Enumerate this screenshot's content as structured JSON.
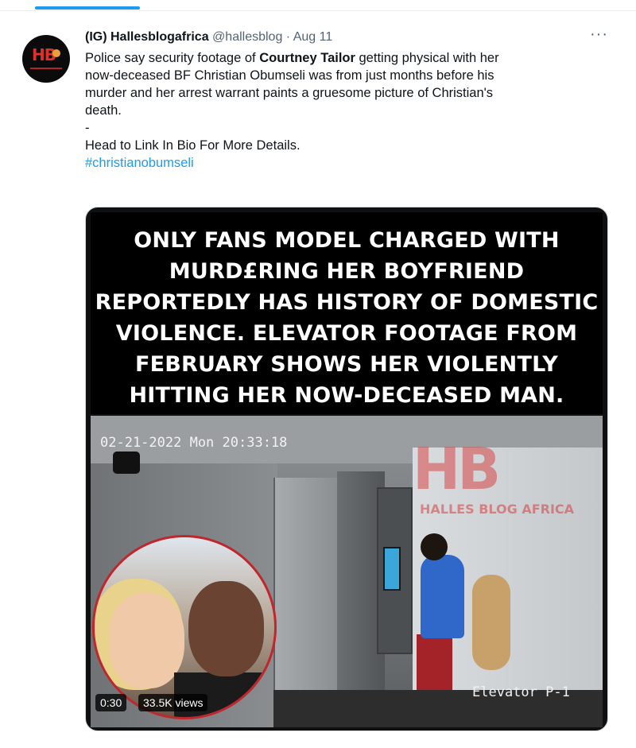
{
  "tweet": {
    "author_name": "(IG) Hallesblogafrica",
    "handle": "@hallesblog",
    "separator": "·",
    "date": "Aug 11",
    "more_label": "···",
    "avatar_icon": "hallesblog-logo-icon",
    "text": {
      "line1_before": "Police say security footage of ",
      "line1_bold": "Courtney Tailor",
      "line1_after": " getting physical with her",
      "line2": "now-deceased BF Christian Obumseli was from just months before his",
      "line3": "murder  and her arrest warrant paints a gruesome picture of Christian's",
      "line4": "death.",
      "line5": "-",
      "line6": "Head to Link In Bio For More Details.",
      "hashtag": "#christianobumseli"
    }
  },
  "media": {
    "caption_lines": [
      "ONLY FANS MODEL CHARGED WITH",
      "MURD£RING HER BOYFRIEND",
      "REPORTEDLY HAS HISTORY OF DOMESTIC",
      "VIOLENCE. ELEVATOR FOOTAGE FROM",
      "FEBRUARY SHOWS HER VIOLENTLY",
      "HITTING HER NOW-DECEASED MAN."
    ],
    "timestamp": "02-21-2022 Mon 20:33:18",
    "camera_label": "Elevator P-1",
    "watermark_letters": "HB",
    "watermark_text": "HALLES BLOG AFRICA",
    "duration": "0:30",
    "views": "33.5K views"
  },
  "colors": {
    "accent": "#1d9bf0",
    "muted": "#536471",
    "text": "#0f1419",
    "inset_border": "#c0272d"
  }
}
